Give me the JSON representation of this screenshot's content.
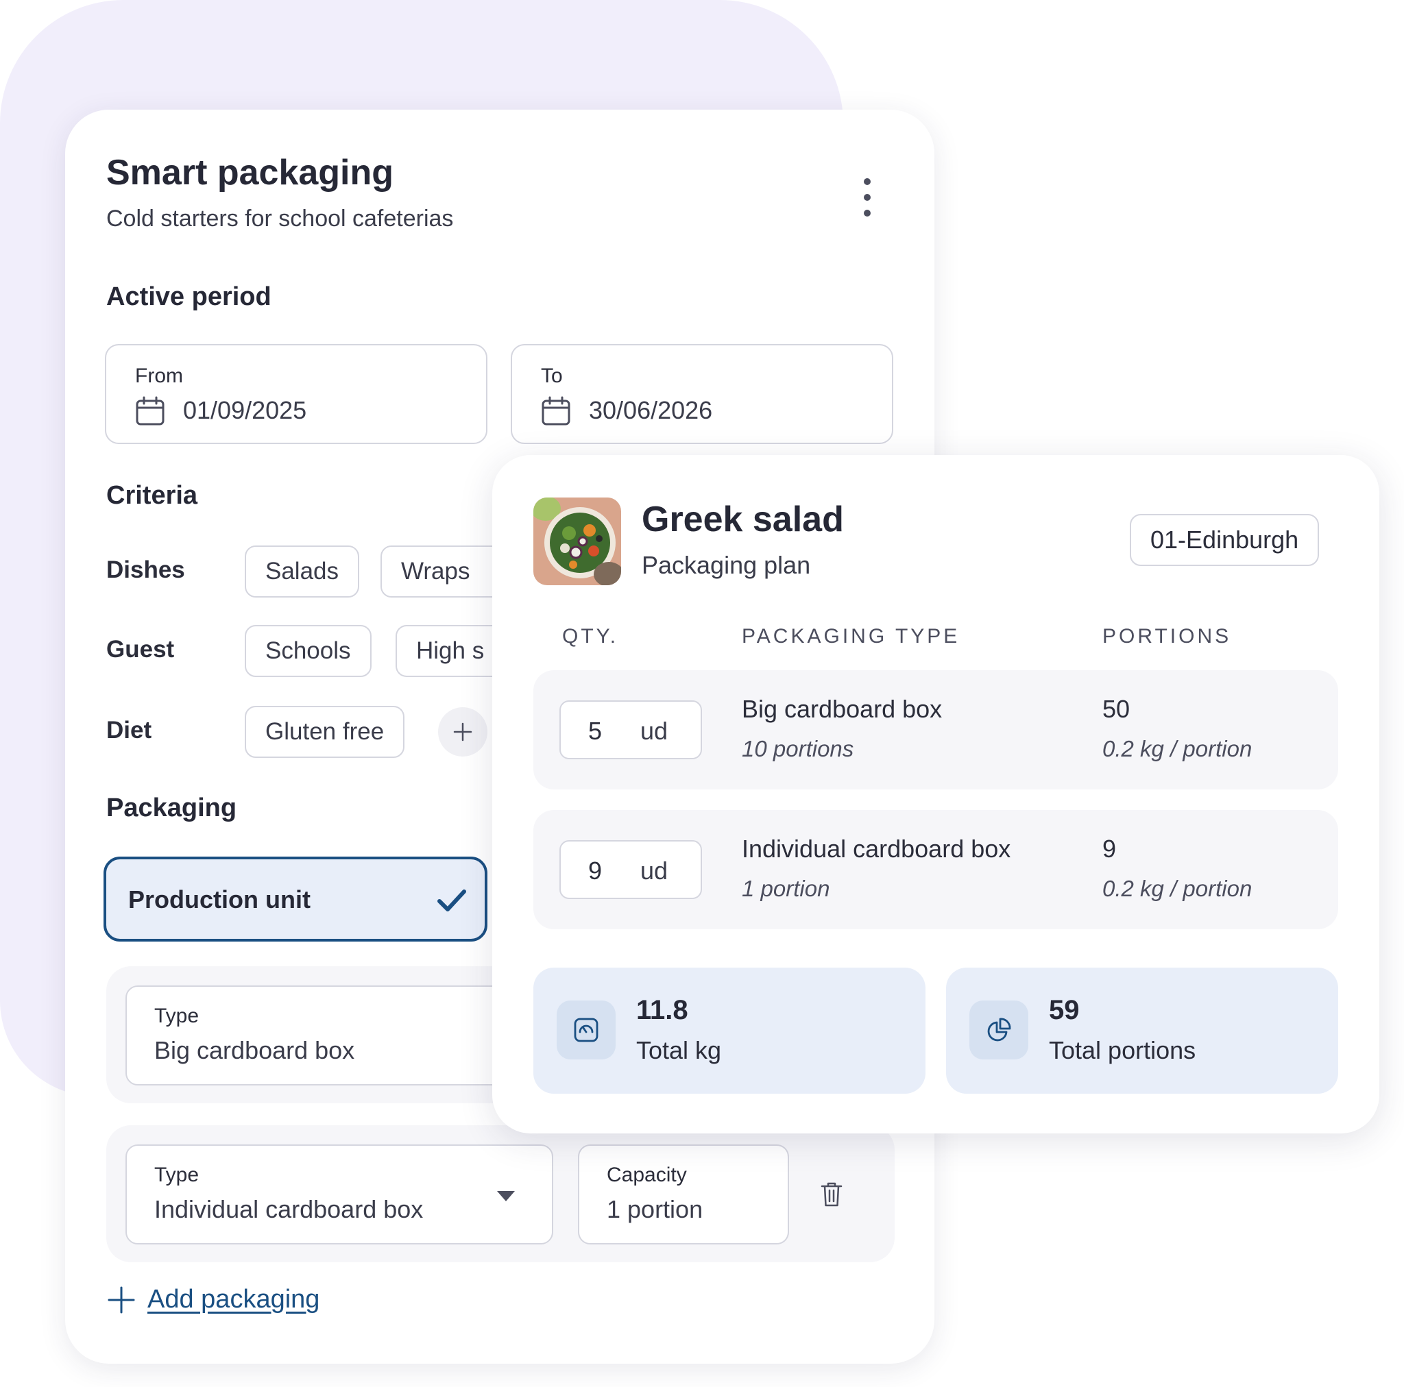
{
  "main": {
    "title": "Smart packaging",
    "subtitle": "Cold starters for school cafeterias",
    "active_period": {
      "heading": "Active period",
      "from_label": "From",
      "from_value": "01/09/2025",
      "to_label": "To",
      "to_value": "30/06/2026"
    },
    "criteria": {
      "heading": "Criteria",
      "dishes_label": "Dishes",
      "dishes": [
        "Salads",
        "Wraps"
      ],
      "guest_label": "Guest",
      "guests": [
        "Schools",
        "High s"
      ],
      "diet_label": "Diet",
      "diets": [
        "Gluten free"
      ]
    },
    "packaging": {
      "heading": "Packaging",
      "unit_option": "Production unit",
      "group1": {
        "type_label": "Type",
        "type_value": "Big cardboard box"
      },
      "group2": {
        "type_label": "Type",
        "type_value": "Individual cardboard box",
        "capacity_label": "Capacity",
        "capacity_value": "1 portion"
      },
      "add_label": "Add packaging"
    }
  },
  "overlay": {
    "title": "Greek salad",
    "subtitle": "Packaging plan",
    "location": "01-Edinburgh",
    "columns": [
      "QTY.",
      "PACKAGING TYPE",
      "PORTIONS"
    ],
    "rows": [
      {
        "qty": "5",
        "unit": "ud",
        "name": "Big cardboard box",
        "sub": "10 portions",
        "portions": "50",
        "kg": "0.2 kg / portion"
      },
      {
        "qty": "9",
        "unit": "ud",
        "name": "Individual cardboard box",
        "sub": "1 portion",
        "portions": "9",
        "kg": "0.2 kg / portion"
      }
    ],
    "stats": {
      "kg_value": "11.8",
      "kg_label": "Total kg",
      "portions_value": "59",
      "portions_label": "Total portions"
    }
  },
  "colors": {
    "accent": "#1a4f82",
    "selected_bg": "#e8eef9",
    "background_blob": "#f1eefb"
  },
  "icons": [
    "more-vertical-icon",
    "calendar-icon",
    "plus-icon",
    "checkmark-icon",
    "chevron-down-icon",
    "trash-icon",
    "scale-icon",
    "pie-chart-icon"
  ]
}
